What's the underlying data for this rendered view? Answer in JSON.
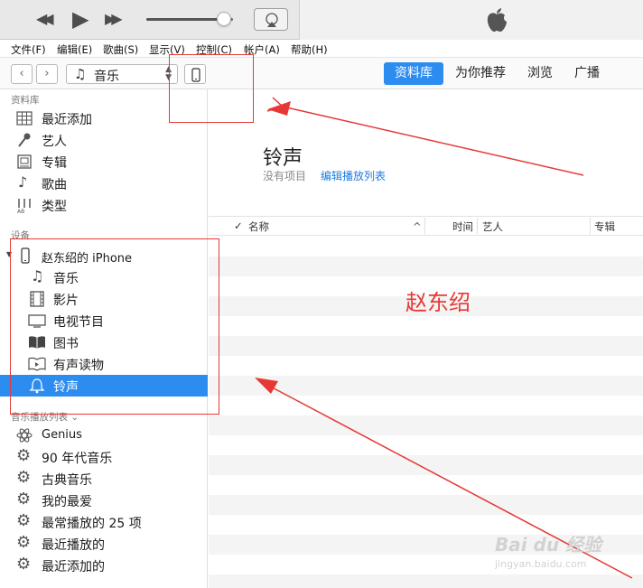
{
  "player": {
    "prev_glyph": "◀◀",
    "play_glyph": "▶",
    "next_glyph": "▶▶",
    "volume_level": 0.9,
    "apple_icon": "apple-logo-icon"
  },
  "menubar": [
    "文件(F)",
    "编辑(E)",
    "歌曲(S)",
    "显示(V)",
    "控制(C)",
    "帐户(A)",
    "帮助(H)"
  ],
  "nav": {
    "back": "‹",
    "forward": "›",
    "media_kind": "音乐",
    "tabs": [
      "资料库",
      "为你推荐",
      "浏览",
      "广播"
    ],
    "active_tab": "资料库"
  },
  "sidebar": {
    "library_header": "资料库",
    "library": [
      "最近添加",
      "艺人",
      "专辑",
      "歌曲",
      "类型"
    ],
    "devices_header": "设备",
    "device_name": "赵东绍的 iPhone",
    "device_items": [
      "音乐",
      "影片",
      "电视节目",
      "图书",
      "有声读物",
      "铃声"
    ],
    "selected_item": "铃声",
    "playlists_header": "音乐播放列表 ⌄",
    "playlists": [
      "Genius",
      "90 年代音乐",
      "古典音乐",
      "我的最爱",
      "最常播放的 25 项",
      "最近播放的",
      "最近添加的"
    ]
  },
  "content": {
    "title": "铃声",
    "empty_text": "没有项目",
    "edit_playlist": "编辑播放列表",
    "columns": {
      "check": "✓",
      "name": "名称",
      "sort_arrow": "^",
      "time": "时间",
      "artist": "艺人",
      "album": "专辑"
    }
  },
  "annotation": {
    "label": "赵东绍",
    "color": "#e53935"
  },
  "watermark": {
    "line1": "Bai du 经验",
    "line2": "jingyan.baidu.com"
  }
}
